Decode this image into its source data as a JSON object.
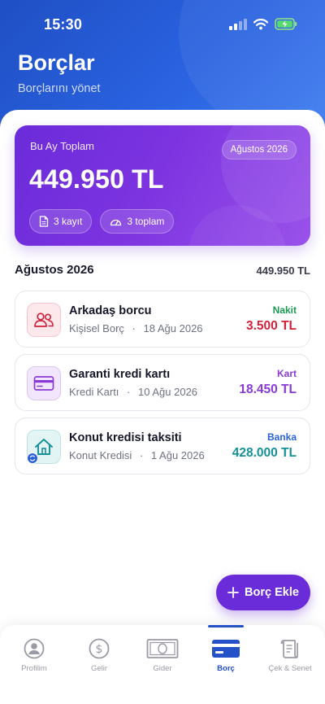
{
  "status_bar": {
    "time": "15:30"
  },
  "header": {
    "title": "Borçlar",
    "subtitle": "Borçlarını yönet"
  },
  "summary": {
    "label": "Bu Ay Toplam",
    "month": "Ağustos 2026",
    "amount": "449.950 TL",
    "records": "3 kayıt",
    "totals": "3 toplam"
  },
  "section": {
    "title": "Ağustos 2026",
    "total": "449.950 TL"
  },
  "debts": [
    {
      "name": "Arkadaş borcu",
      "category": "Kişisel Borç",
      "date": "18 Ağu 2026",
      "type": "Nakit",
      "amount": "3.500 TL",
      "type_color": "#1a9a54",
      "amount_color": "#d0223a",
      "icon": "people-icon"
    },
    {
      "name": "Garanti kredi kartı",
      "category": "Kredi Kartı",
      "date": "10 Ağu 2026",
      "type": "Kart",
      "amount": "18.450 TL",
      "type_color": "#8a3ad6",
      "amount_color": "#8a3ad6",
      "icon": "credit-card-icon"
    },
    {
      "name": "Konut kredisi taksiti",
      "category": "Konut Kredisi",
      "date": "1 Ağu 2026",
      "type": "Banka",
      "amount": "428.000 TL",
      "type_color": "#2a62d8",
      "amount_color": "#159099",
      "icon": "house-icon"
    }
  ],
  "meta_separator": "·",
  "fab": {
    "label": "Borç Ekle"
  },
  "tabs": [
    {
      "label": "Profilim",
      "icon": "profile-icon"
    },
    {
      "label": "Gelir",
      "icon": "dollar-icon"
    },
    {
      "label": "Gider",
      "icon": "banknote-icon"
    },
    {
      "label": "Borç",
      "icon": "card-icon",
      "active": true
    },
    {
      "label": "Çek & Senet",
      "icon": "scroll-icon"
    }
  ],
  "colors": {
    "header_blue": "#2a62e0",
    "accent_purple": "#6a2bd8",
    "tab_active": "#2450c8"
  }
}
